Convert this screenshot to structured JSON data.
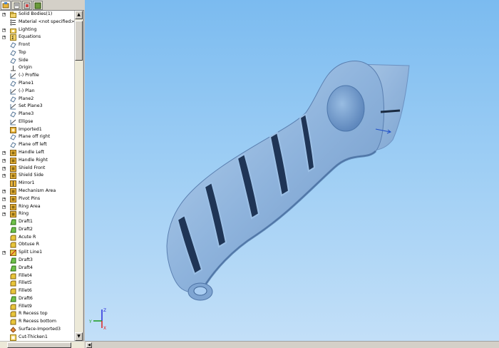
{
  "feature_tree": {
    "items": [
      {
        "label": "Solid Bodies(1)",
        "icon": "folder-icon",
        "expandable": true
      },
      {
        "label": "Material <not specified>",
        "icon": "material-icon",
        "expandable": false
      },
      {
        "label": "Lighting",
        "icon": "lighting-folder-icon",
        "expandable": true
      },
      {
        "label": "Equations",
        "icon": "equations-icon",
        "expandable": true
      },
      {
        "label": "Front",
        "icon": "plane-icon",
        "expandable": false
      },
      {
        "label": "Top",
        "icon": "plane-icon",
        "expandable": false
      },
      {
        "label": "Side",
        "icon": "plane-icon",
        "expandable": false
      },
      {
        "label": "Origin",
        "icon": "origin-icon",
        "expandable": false
      },
      {
        "label": "(-) Profile",
        "icon": "sketch-icon",
        "expandable": false
      },
      {
        "label": "Plane1",
        "icon": "plane-icon",
        "expandable": false
      },
      {
        "label": "(-) Plan",
        "icon": "sketch-icon",
        "expandable": false
      },
      {
        "label": "Plane2",
        "icon": "plane-icon",
        "expandable": false
      },
      {
        "label": "Set Plane3",
        "icon": "sketch-icon",
        "expandable": false
      },
      {
        "label": "Plane3",
        "icon": "plane-icon",
        "expandable": false
      },
      {
        "label": "Ellipse",
        "icon": "sketch-icon",
        "expandable": false
      },
      {
        "label": "Imported1",
        "icon": "imported-icon",
        "expandable": false
      },
      {
        "label": "Plane off right",
        "icon": "plane-icon",
        "expandable": false
      },
      {
        "label": "Plane off left",
        "icon": "plane-icon",
        "expandable": false
      },
      {
        "label": "Handle Left",
        "icon": "feature-icon",
        "expandable": true
      },
      {
        "label": "Handle Right",
        "icon": "feature-icon",
        "expandable": true
      },
      {
        "label": "Shield Front",
        "icon": "feature-icon",
        "expandable": true
      },
      {
        "label": "Shield Side",
        "icon": "feature-icon",
        "expandable": true
      },
      {
        "label": "Mirror1",
        "icon": "mirror-icon",
        "expandable": false
      },
      {
        "label": "Mechanism Area",
        "icon": "feature-icon",
        "expandable": true
      },
      {
        "label": "Pivot Pins",
        "icon": "feature-icon",
        "expandable": true
      },
      {
        "label": "Ring Area",
        "icon": "feature-icon",
        "expandable": true
      },
      {
        "label": "Ring",
        "icon": "feature-icon",
        "expandable": true
      },
      {
        "label": "Draft1",
        "icon": "draft-icon",
        "expandable": false
      },
      {
        "label": "Draft2",
        "icon": "draft-icon",
        "expandable": false
      },
      {
        "label": "Acute R",
        "icon": "fillet-icon",
        "expandable": false
      },
      {
        "label": "Obtuse R",
        "icon": "fillet-icon",
        "expandable": false
      },
      {
        "label": "Split Line1",
        "icon": "split-line-icon",
        "expandable": true
      },
      {
        "label": "Draft3",
        "icon": "draft-icon",
        "expandable": false
      },
      {
        "label": "Draft4",
        "icon": "draft-icon",
        "expandable": false
      },
      {
        "label": "Fillet4",
        "icon": "fillet-icon",
        "expandable": false
      },
      {
        "label": "Fillet5",
        "icon": "fillet-icon",
        "expandable": false
      },
      {
        "label": "Fillet6",
        "icon": "fillet-icon",
        "expandable": false
      },
      {
        "label": "Draft6",
        "icon": "draft-icon",
        "expandable": false
      },
      {
        "label": "Fillet9",
        "icon": "fillet-icon",
        "expandable": false
      },
      {
        "label": "R Recess top",
        "icon": "fillet-icon",
        "expandable": false
      },
      {
        "label": "R Recess bottom",
        "icon": "fillet-icon",
        "expandable": false
      },
      {
        "label": "Surface-Imported3",
        "icon": "surface-icon",
        "expandable": false
      },
      {
        "label": "Cut-Thicken1",
        "icon": "cut-icon",
        "expandable": false
      }
    ]
  },
  "panel_tabs": [
    {
      "icon": "feature-manager-tab-icon",
      "active": true
    },
    {
      "icon": "property-manager-tab-icon",
      "active": false
    },
    {
      "icon": "configuration-manager-tab-icon",
      "active": false
    },
    {
      "icon": "dimxpert-tab-icon",
      "active": false
    }
  ],
  "triad": {
    "x_label": "X",
    "y_label": "Y",
    "z_label": "Z"
  },
  "colors": {
    "part": "#8fb4dd",
    "part_shadow": "#2a4466",
    "viewport_top": "#7bbbf0",
    "viewport_bottom": "#c4e0f8"
  }
}
